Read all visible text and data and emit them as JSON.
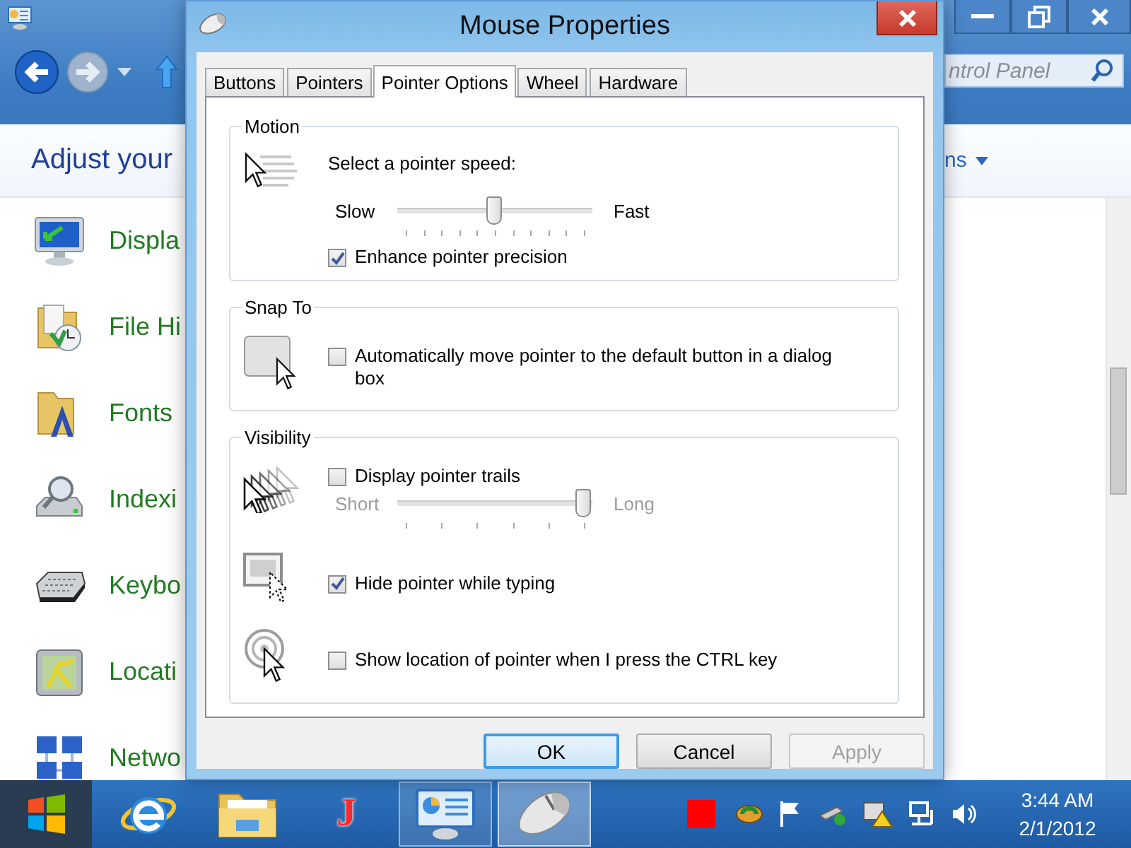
{
  "explorer": {
    "heading": "Adjust your",
    "view_link": "ns",
    "search": {
      "placeholder": "ntrol Panel"
    },
    "items": [
      {
        "kind": "display",
        "label": "Displa"
      },
      {
        "kind": "history",
        "label": "File Hi"
      },
      {
        "kind": "fonts",
        "label": "Fonts"
      },
      {
        "kind": "indexing",
        "label": "Indexi"
      },
      {
        "kind": "keyboard",
        "label": "Keybo"
      },
      {
        "kind": "location",
        "label": "Locati"
      },
      {
        "kind": "network",
        "label": "Netwo"
      }
    ]
  },
  "dialog": {
    "title": "Mouse Properties",
    "tabs": [
      {
        "label": "Buttons",
        "selected": false
      },
      {
        "label": "Pointers",
        "selected": false
      },
      {
        "label": "Pointer Options",
        "selected": true
      },
      {
        "label": "Wheel",
        "selected": false
      },
      {
        "label": "Hardware",
        "selected": false
      }
    ],
    "groups": [
      {
        "legend": "Motion",
        "sections": [
          {
            "kind": "speed",
            "rows": [
              {
                "kind": "text",
                "text": "Select a pointer speed:"
              },
              {
                "kind": "slider",
                "min_label": "Slow",
                "max_label": "Fast",
                "level": 0.5,
                "disabled": false
              },
              {
                "kind": "checkbox",
                "label": "Enhance pointer precision",
                "checked": true
              }
            ]
          }
        ]
      },
      {
        "legend": "Snap To",
        "sections": [
          {
            "kind": "snap",
            "rows": [
              {
                "kind": "checkbox",
                "label": "Automatically move pointer to the default button in a dialog box",
                "checked": false
              }
            ]
          }
        ]
      },
      {
        "legend": "Visibility",
        "sections": [
          {
            "kind": "trails",
            "rows": [
              {
                "kind": "checkbox",
                "label": "Display pointer trails",
                "checked": false
              },
              {
                "kind": "slider",
                "min_label": "Short",
                "max_label": "Long",
                "level": 1,
                "disabled": true
              }
            ]
          },
          {
            "kind": "hide",
            "rows": [
              {
                "kind": "checkbox",
                "label": "Hide pointer while typing",
                "checked": true
              }
            ]
          },
          {
            "kind": "locate",
            "rows": [
              {
                "kind": "checkbox",
                "label": "Show location of pointer when I press the CTRL key",
                "checked": false
              }
            ]
          }
        ]
      }
    ],
    "buttons": [
      {
        "label": "OK",
        "default": true,
        "disabled": false
      },
      {
        "label": "Cancel",
        "default": false,
        "disabled": false
      },
      {
        "label": "Apply",
        "default": false,
        "disabled": true
      }
    ]
  },
  "taskbar": {
    "apps": [
      {
        "kind": "browser",
        "open": false,
        "selected": false
      },
      {
        "kind": "folder",
        "open": false,
        "selected": false
      },
      {
        "kind": "letter",
        "label": "J",
        "open": false,
        "selected": false
      },
      {
        "kind": "control-panel",
        "open": true,
        "selected": false
      },
      {
        "kind": "mouse",
        "open": true,
        "selected": true
      }
    ],
    "time": "3:44 AM",
    "date": "2/1/2012"
  }
}
